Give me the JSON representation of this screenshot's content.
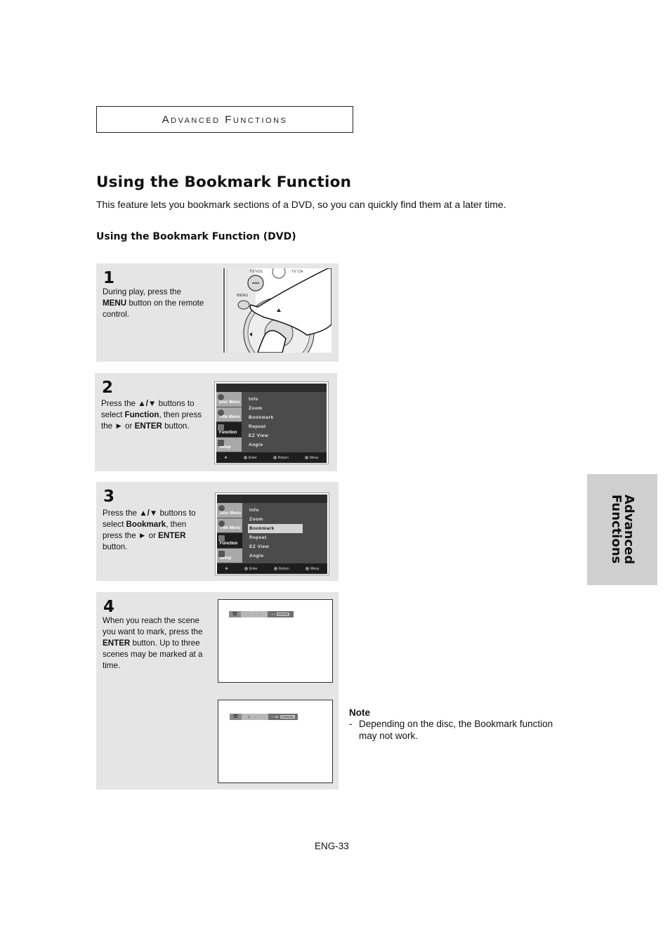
{
  "header": {
    "section_title": "Advanced Functions"
  },
  "page": {
    "title": "Using the Bookmark Function",
    "intro": "This feature lets you bookmark sections of a DVD, so you can quickly find them at a later time.",
    "subtitle": "Using the Bookmark Function (DVD)"
  },
  "steps": [
    {
      "number": "1",
      "text_parts": [
        "During play, press the ",
        "MENU",
        " button on the remote control."
      ],
      "remote_labels": {
        "tv_vol": "TV VOL",
        "tv_ch": "TV CH",
        "menu": "MENU"
      }
    },
    {
      "number": "2",
      "text_parts": [
        "Press the ",
        "▲/▼",
        " buttons to select ",
        "Function",
        ", then press the ",
        "►",
        " or ",
        "ENTER",
        " button."
      ]
    },
    {
      "number": "3",
      "text_parts": [
        "Press the ",
        "▲/▼",
        " buttons to select ",
        "Bookmark",
        ", then press the ",
        "►",
        " or ",
        "ENTER",
        " button."
      ]
    },
    {
      "number": "4",
      "text_parts": [
        "When you reach the scene you want to mark, press the ",
        "ENTER",
        " button. Up to three scenes may be marked at a time."
      ]
    }
  ],
  "osd_menu": {
    "side": [
      "Disc Menu",
      "Title Menu",
      "Function",
      "Setup"
    ],
    "active_side": "Function",
    "items": [
      "Info",
      "Zoom",
      "Bookmark",
      "Repeat",
      "EZ View",
      "Angle"
    ],
    "footer": {
      "enter": "Enter",
      "return": "Return",
      "menu": "Menu"
    }
  },
  "bookmark_bars": [
    {
      "slots": [
        "-",
        "-",
        "-"
      ],
      "action": "ENTER",
      "nav": "‹ ›"
    },
    {
      "slots": [
        "1",
        "-",
        "-"
      ],
      "action": "CANCEL",
      "nav": "‹ › ⊙"
    }
  ],
  "note": {
    "title": "Note",
    "dash": "-",
    "body": "Depending on the disc, the Bookmark function may not work."
  },
  "side_tab": {
    "label": "Advanced\nFunctions"
  },
  "footer": {
    "page_number": "ENG-33"
  }
}
